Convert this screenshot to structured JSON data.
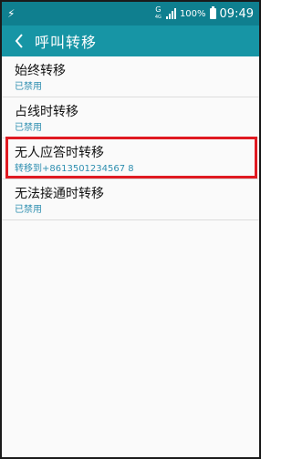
{
  "status_bar": {
    "usb_icon": "usb-icon",
    "network_type": "G",
    "network_sub": "4G",
    "battery_percent": "100%",
    "time": "09:49"
  },
  "app_bar": {
    "title": "呼叫转移",
    "back_icon": "chevron-left-icon"
  },
  "rows": [
    {
      "label": "始终转移",
      "status": "已禁用"
    },
    {
      "label": "占线时转移",
      "status": "已禁用"
    },
    {
      "label": "无人应答时转移",
      "status": "转移到+8613501234567 8"
    },
    {
      "label": "无法接通时转移",
      "status": "已禁用"
    }
  ],
  "colors": {
    "status_bar": "#0f7f8f",
    "app_bar": "#1795a5",
    "secondary_text": "#2f8fb0",
    "highlight": "#e01a22"
  }
}
